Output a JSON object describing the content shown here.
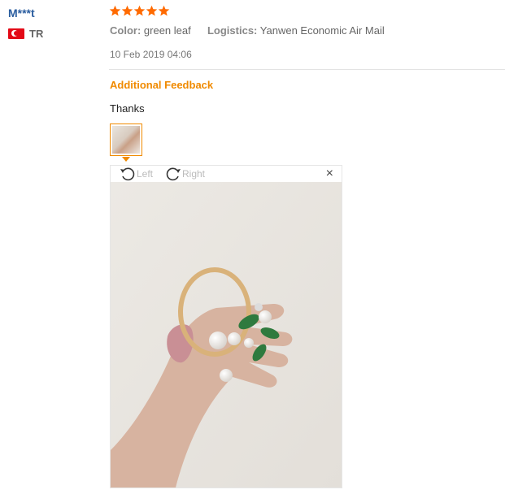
{
  "review": {
    "user_name": "M***t",
    "country_code": "TR",
    "rating": 5,
    "color_label": "Color:",
    "color_value": "green leaf",
    "logistics_label": "Logistics:",
    "logistics_value": "Yanwen Economic Air Mail",
    "date": "10 Feb 2019 04:06",
    "additional_label": "Additional Feedback",
    "comment": "Thanks"
  },
  "viewer": {
    "rotate_left_label": "Left",
    "rotate_right_label": "Right",
    "close_symbol": "×"
  },
  "colors": {
    "accent": "#f08a00",
    "star": "#ff6a00",
    "user_link": "#2a5d9f"
  }
}
